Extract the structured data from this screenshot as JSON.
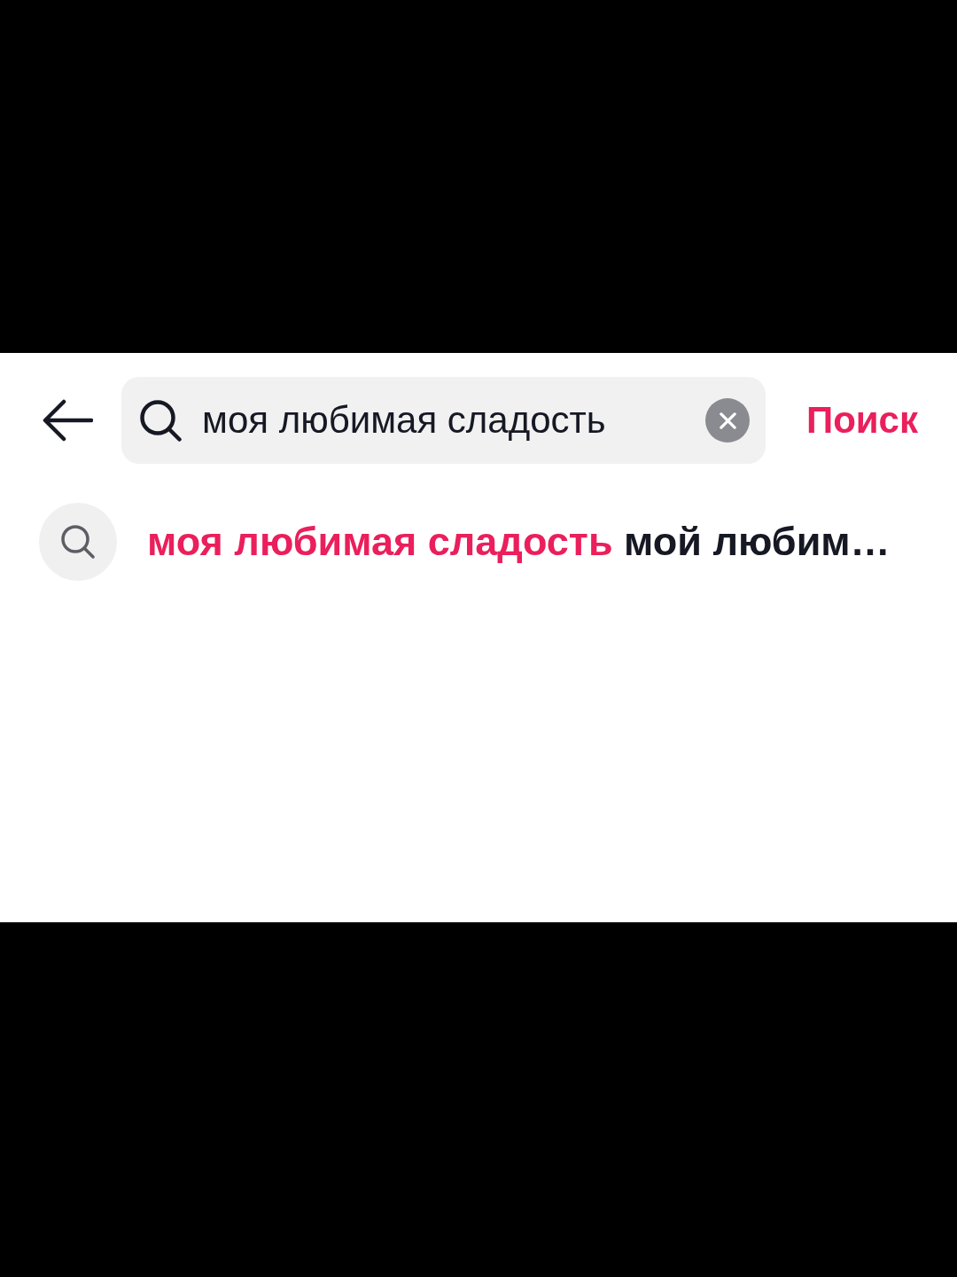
{
  "search_bar": {
    "value": "моя любимая сладость",
    "submit_label": "Поиск"
  },
  "suggestions": [
    {
      "matched": "моя любимая сладость",
      "rest": "мой любим…"
    }
  ]
}
